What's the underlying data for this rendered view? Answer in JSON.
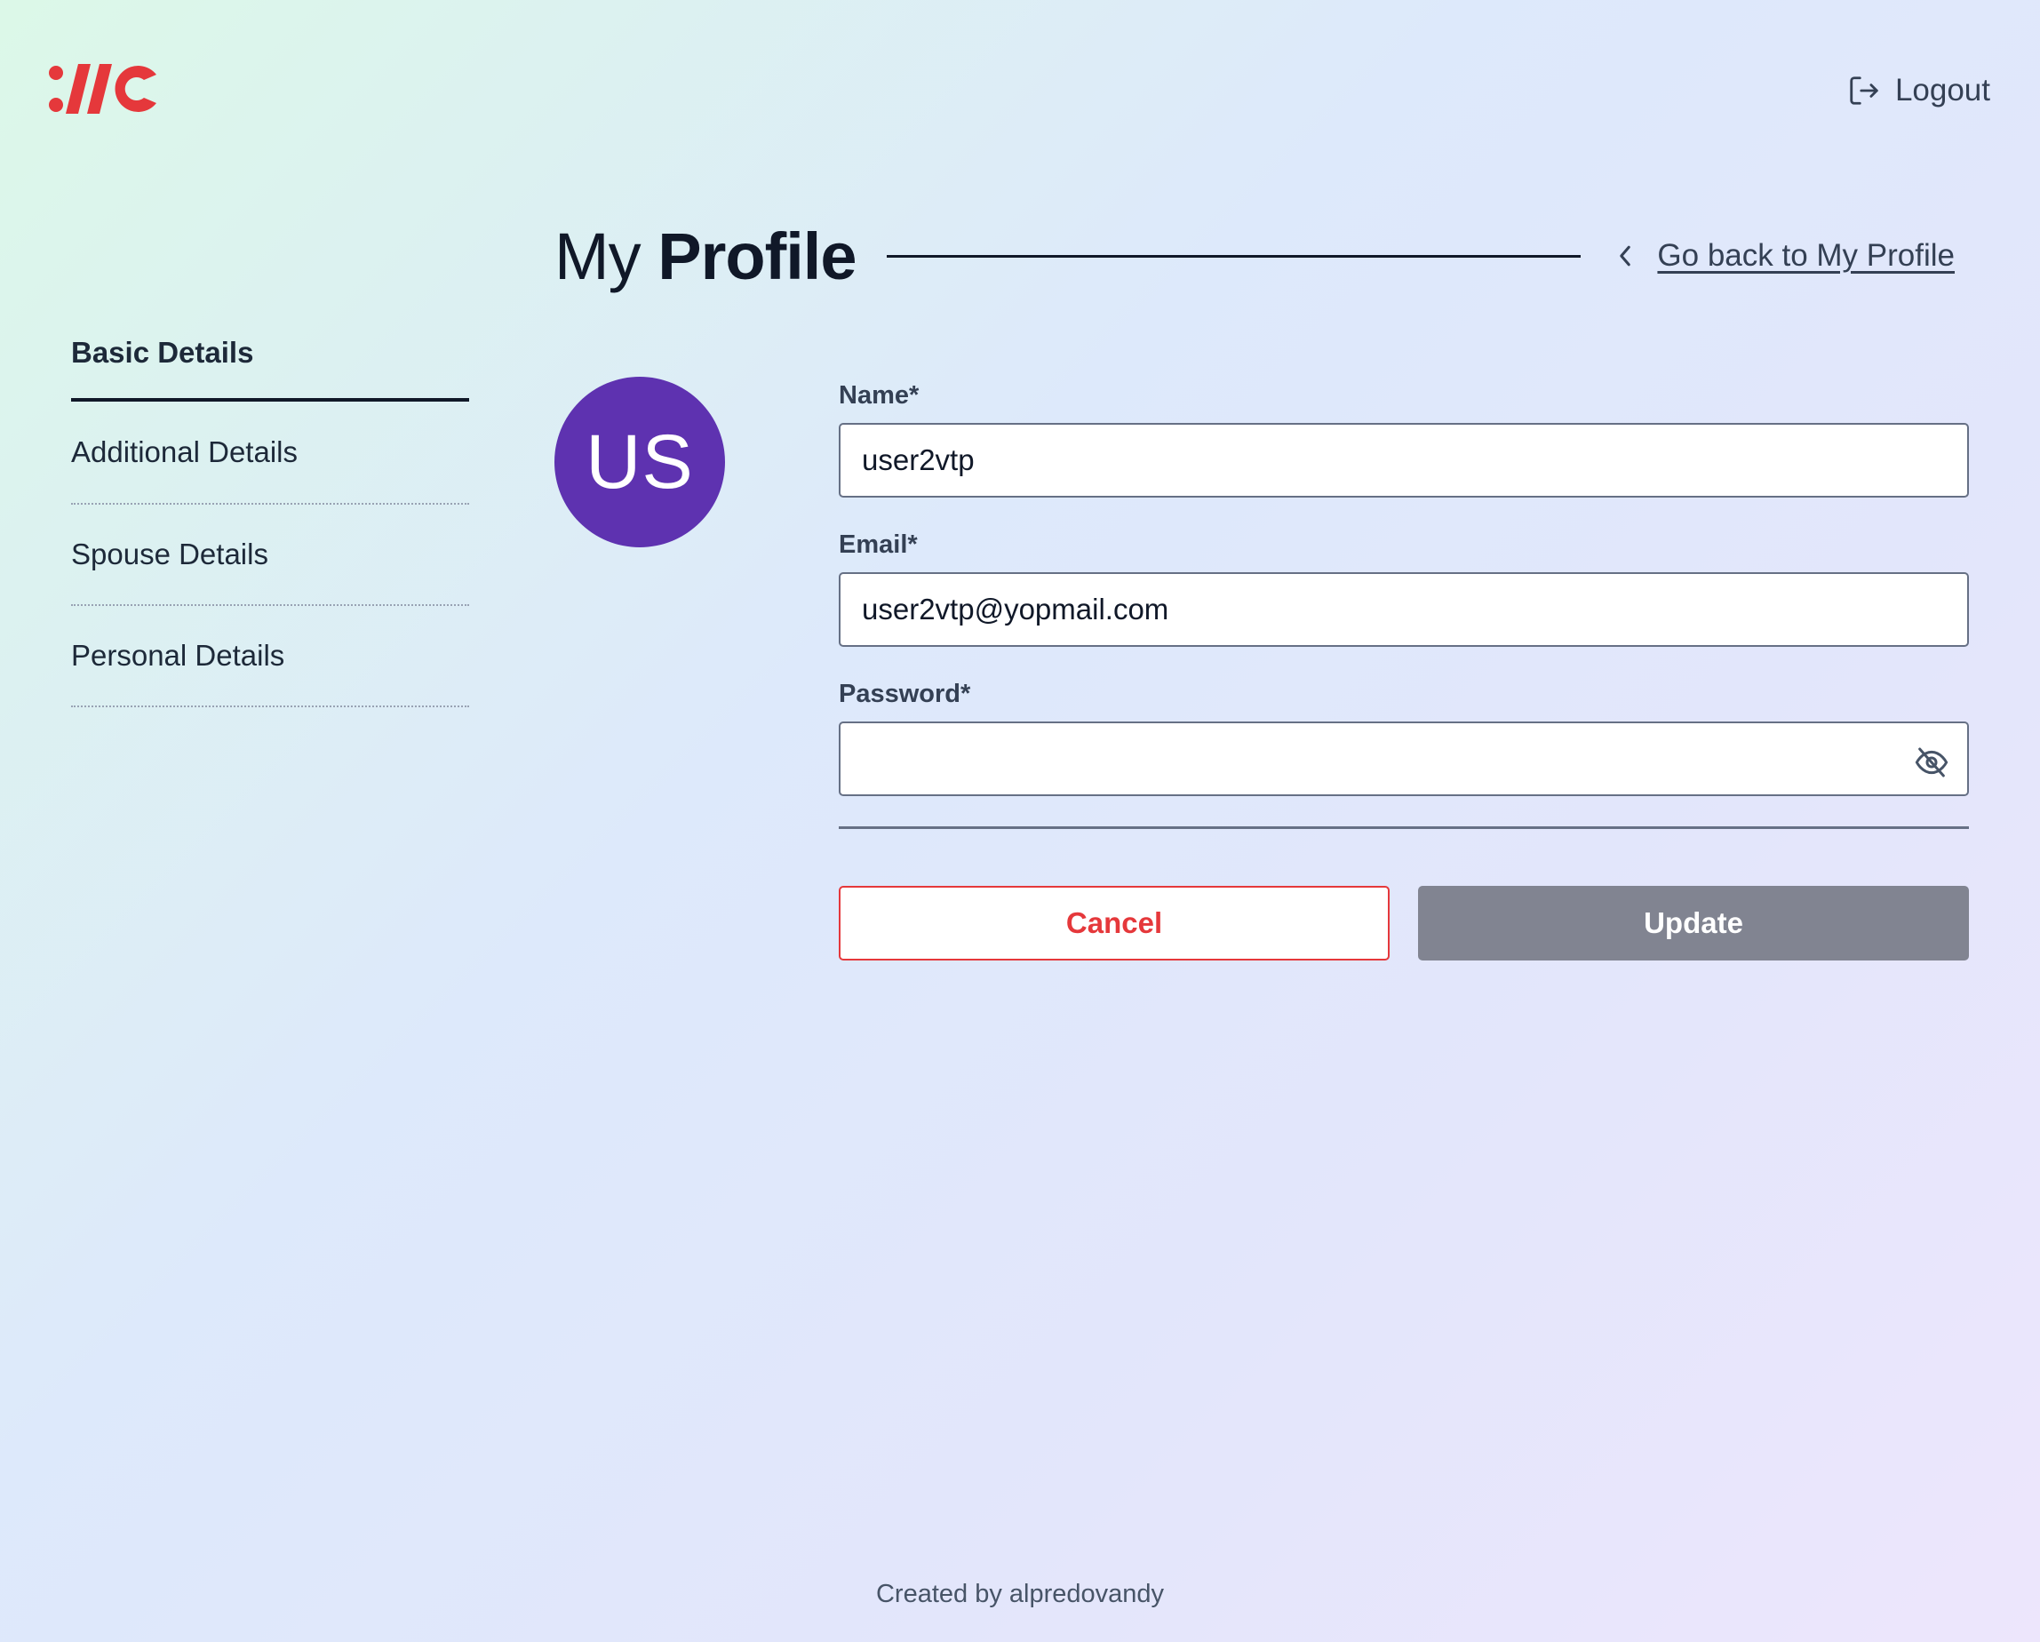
{
  "header": {
    "logo_text": "://C",
    "logout_label": "Logout"
  },
  "title": {
    "prefix": "My",
    "bold": "Profile",
    "back_link": "Go back to My Profile"
  },
  "sidebar": {
    "items": [
      {
        "label": "Basic Details",
        "active": true
      },
      {
        "label": "Additional Details",
        "active": false
      },
      {
        "label": "Spouse Details",
        "active": false
      },
      {
        "label": "Personal Details",
        "active": false
      }
    ]
  },
  "avatar": {
    "initials": "US",
    "color": "#5e32b0"
  },
  "form": {
    "name_label": "Name*",
    "name_value": "user2vtp",
    "email_label": "Email*",
    "email_value": "user2vtp@yopmail.com",
    "password_label": "Password*",
    "password_value": "",
    "password_toggle_icon": "eye-off-icon",
    "cancel_label": "Cancel",
    "update_label": "Update"
  },
  "colors": {
    "brand": "#e5383b",
    "cancel": "#e5383b",
    "update_disabled": "#818491"
  },
  "footer": {
    "text": "Created by alpredovandy"
  }
}
